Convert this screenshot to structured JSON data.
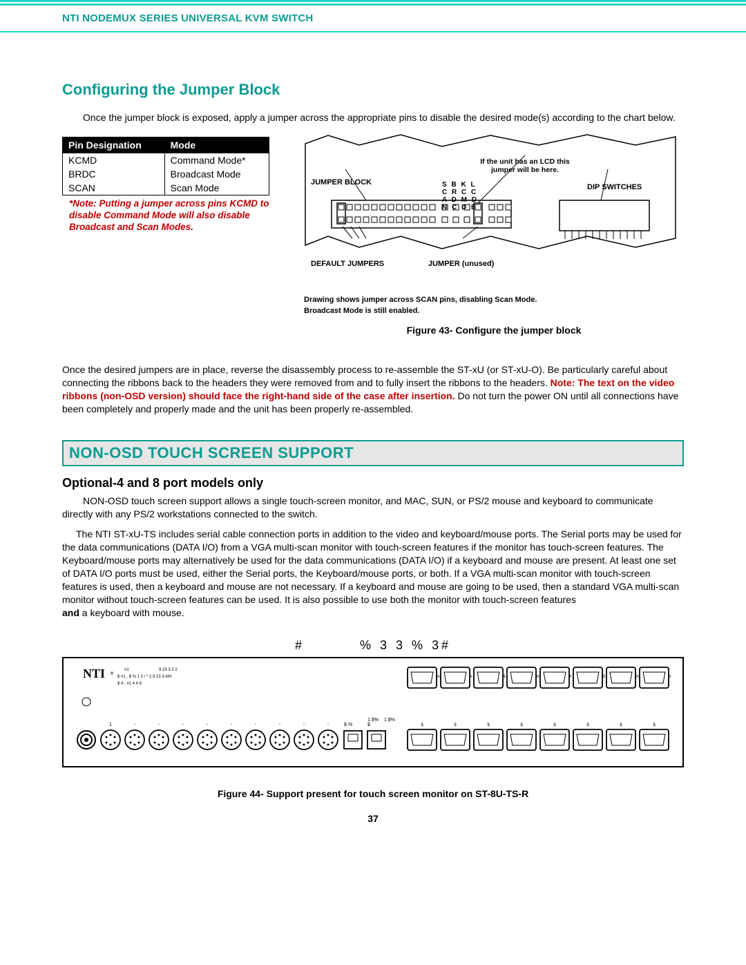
{
  "header": {
    "title": "NTI NODEMUX SERIES UNIVERSAL KVM SWITCH"
  },
  "section1": {
    "heading": "Configuring the Jumper Block",
    "intro": "Once the jumper block is exposed, apply a jumper across the appropriate pins to disable the desired mode(s) according to the chart below.",
    "table_headers": {
      "col1": "Pin Designation",
      "col2": "Mode"
    },
    "rows": [
      {
        "pin": "KCMD",
        "mode": "Command Mode*"
      },
      {
        "pin": "BRDC",
        "mode": "Broadcast Mode"
      },
      {
        "pin": "SCAN",
        "mode": "Scan Mode"
      }
    ],
    "note_star": "*Note:  Putting a jumper across pins KCMD to disable Command Mode will also disable Broadcast and Scan Modes.",
    "diagram": {
      "jumper_block": "JUMPER BLOCK",
      "lcd_note": "If the unit has an LCD this jumper will be here.",
      "dip": "DIP SWITCHES",
      "default_jumpers": "DEFAULT JUMPERS",
      "jumper_unused": "JUMPER (unused)",
      "grid_row1": "S  B  K  L",
      "grid_row2": "C  R  C  C",
      "grid_row3": "A  D  M  D",
      "grid_row4": "N  C  D  E",
      "caption_sub1": "Drawing shows jumper across SCAN pins, disabling Scan Mode.",
      "caption_sub2": "Broadcast Mode is still enabled.",
      "figure_caption": "Figure 43- Configure the jumper block"
    },
    "para2_a": "Once the desired jumpers are in place, reverse the disassembly process to re-assemble the ST-xU (or ST-xU-O).   Be particularly careful about connecting the ribbons back to the headers they were removed from and to fully insert the ribbons to the headers.  ",
    "para2_red": "Note: The text on the video ribbons (non-OSD version) should face the right-hand side of the case after insertion.",
    "para2_b": "   Do not turn the power ON until all connections have been completely and properly made and the unit has been properly re-assembled."
  },
  "section2": {
    "bar_title": "NON-OSD TOUCH SCREEN SUPPORT",
    "subheading": "Optional-4 and 8 port models only",
    "para1": "NON-OSD touch screen support allows a single touch-screen monitor, and MAC, SUN, or PS/2 mouse and keyboard to communicate directly with any PS/2 workstations connected to the switch.",
    "para2a": "The NTI ST-xU-TS includes serial cable connection ports in addition to the video and keyboard/mouse  ports.  The Serial ports may be used for the data communications (DATA I/O) from a VGA multi-scan monitor with touch-screen features if the monitor has touch-screen features. The Keyboard/mouse ports may alternatively be used for the data communications (DATA I/O) if a keyboard and mouse are present.    At least one set of DATA I/O ports must be used, either the Serial ports, the Keyboard/mouse ports, or both.    If a VGA multi-scan monitor with touch-screen features is used, then a keyboard and mouse are not necessary.  If a keyboard and mouse are going to be used, then a standard VGA multi-scan monitor without touch-screen features can be used.    It is also possible to use both the monitor with touch-screen features ",
    "para2_bold": "and",
    "para2b": " a keyboard with mouse.",
    "serial_label_1": "#",
    "serial_label_2": "%  3    3  % 3#",
    "figure_caption": "Figure 44- Support present for touch screen monitor on ST-8U-TS-R"
  },
  "page_number": "37"
}
